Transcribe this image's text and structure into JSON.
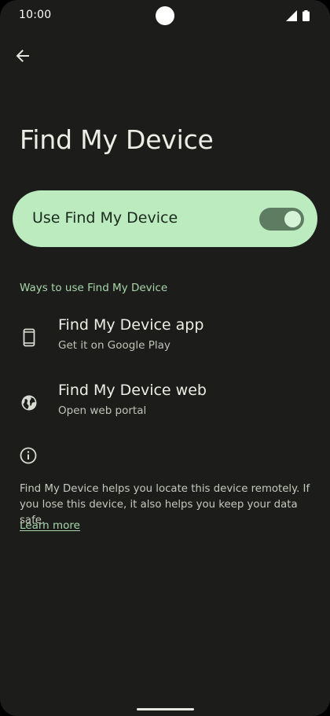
{
  "status_bar": {
    "time": "10:00",
    "icons": [
      "signal-icon",
      "battery-icon"
    ]
  },
  "header": {
    "back_icon": "arrow-back-icon",
    "title": "Find My Device"
  },
  "main_toggle": {
    "label": "Use Find My Device",
    "state": "on"
  },
  "section": {
    "header": "Ways to use Find My Device",
    "items": [
      {
        "icon": "phone-icon",
        "title": "Find My Device app",
        "subtitle": "Get it on Google Play"
      },
      {
        "icon": "globe-icon",
        "title": "Find My Device web",
        "subtitle": "Open web portal"
      }
    ]
  },
  "footer": {
    "icon": "info-icon",
    "text": "Find My Device helps you locate this device remotely. If you lose this device, it also helps you keep your data safe.",
    "link": "Learn more"
  },
  "colors": {
    "background": "#1c1d1a",
    "toggle_card": "#bcebbf",
    "switch_track": "#5e7c62",
    "accent_text": "#a8d5ab"
  }
}
